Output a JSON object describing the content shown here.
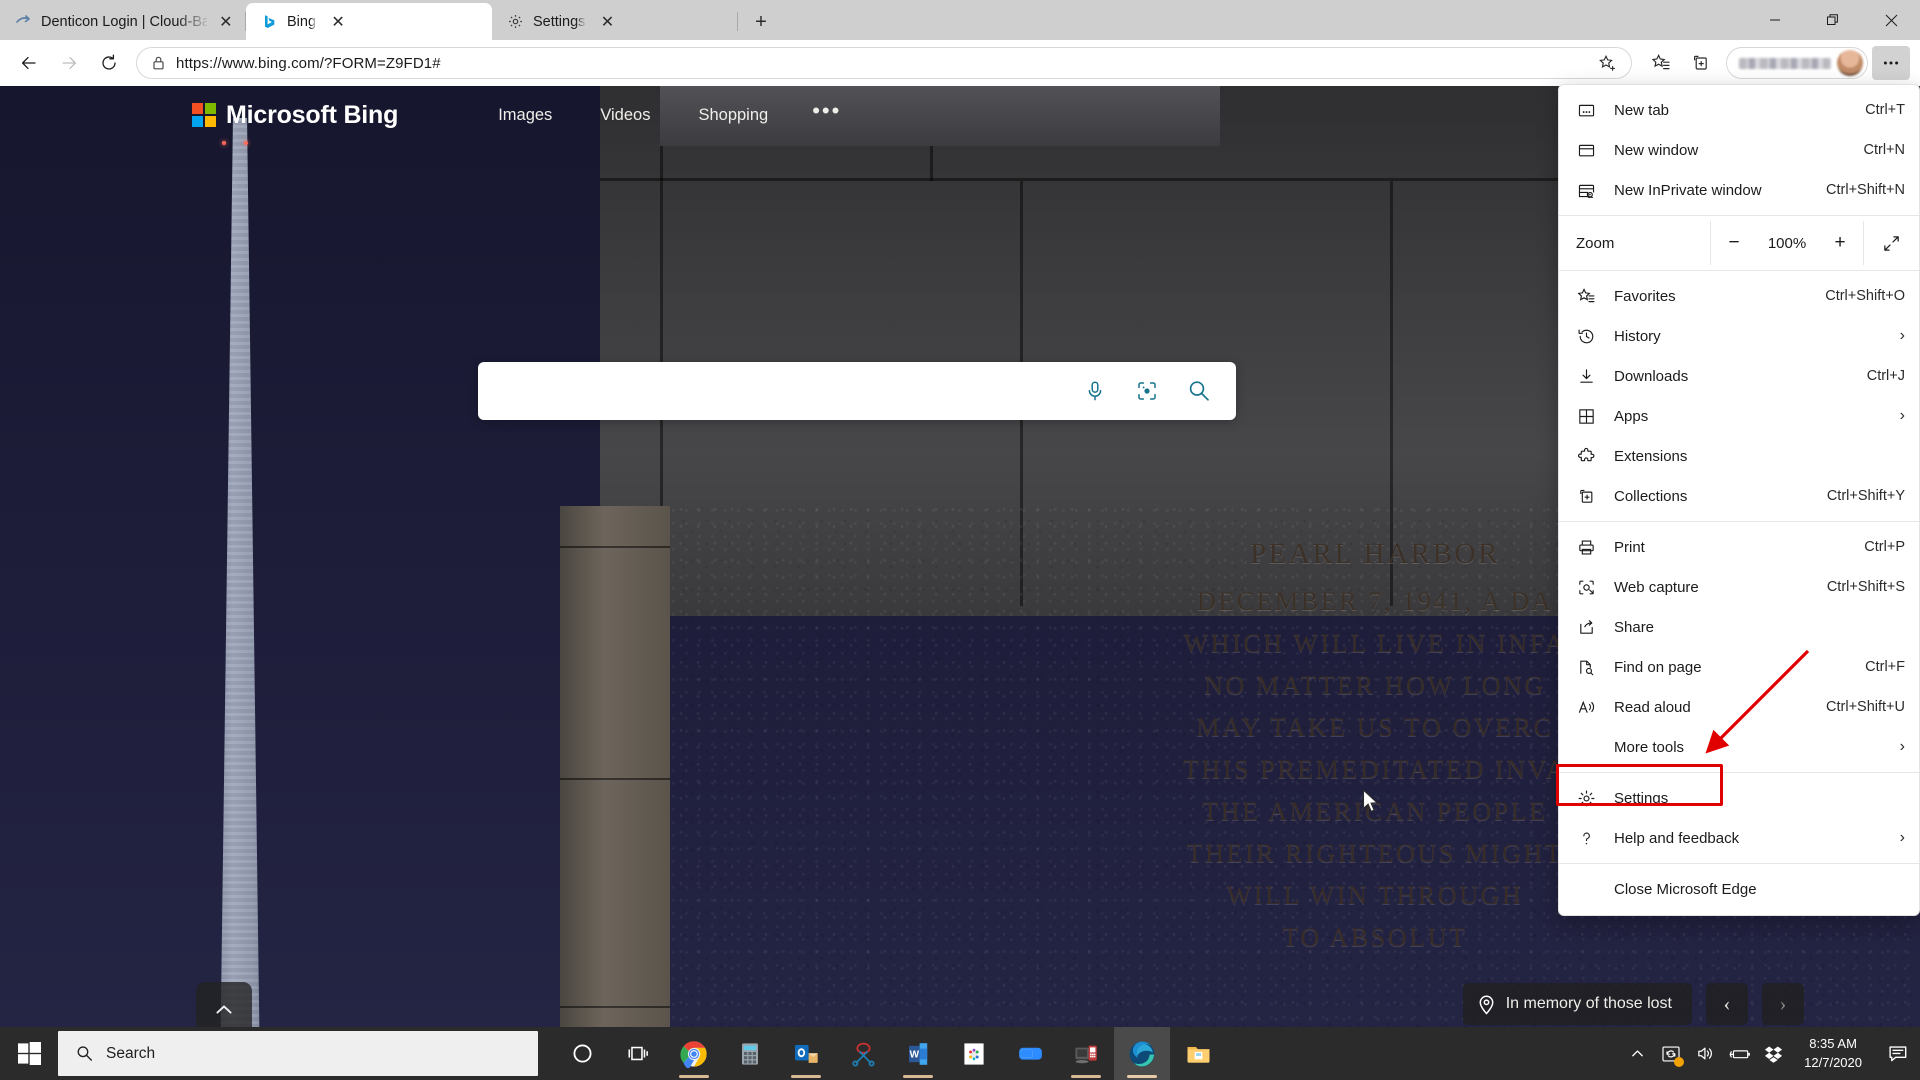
{
  "window": {
    "controls": {
      "minimize": "—",
      "restore": "restore",
      "close": "✕"
    }
  },
  "tabs": [
    {
      "title": "Denticon Login | Cloud-Based Pr",
      "favicon": "denticon-icon",
      "active": false,
      "close": "✕"
    },
    {
      "title": "Bing",
      "favicon": "bing-icon",
      "active": true,
      "close": "✕"
    },
    {
      "title": "Settings",
      "favicon": "gear-icon",
      "active": false,
      "close": "✕"
    }
  ],
  "new_tab_button": "+",
  "toolbar": {
    "back": "back-arrow-icon",
    "forward": "forward-arrow-icon",
    "refresh": "refresh-icon",
    "url": "https://www.bing.com/?FORM=Z9FD1#",
    "url_scheme": "https://",
    "url_rest": "www.bing.com/?FORM=Z9FD1#",
    "lock": "lock-icon",
    "add_favorite": "star-plus-icon",
    "favorites": "favorites-icon",
    "collections": "collections-icon",
    "profile_name": "",
    "more": "…"
  },
  "bing": {
    "logo_text": "Microsoft Bing",
    "nav": [
      "Images",
      "Videos",
      "Shopping"
    ],
    "nav_more": "•••",
    "search_placeholder": "",
    "search_value": "",
    "search_icons": [
      "microphone-icon",
      "visual-search-icon",
      "search-icon"
    ],
    "scroll_top": "chevron-up-icon",
    "infobar_text": "In memory of those lost",
    "infobar_icon": "location-pin-icon",
    "prev_arrow": "‹",
    "next_arrow": "›",
    "inscription": {
      "title": "PEARL HARBOR",
      "lines": [
        "DECEMBER 7, 1941, A DA",
        "WHICH WILL LIVE IN INFA",
        "NO MATTER HOW LONG",
        "MAY TAKE US TO OVERC",
        "THIS PREMEDITATED INVA",
        "THE AMERICAN PEOPLE",
        "THEIR RIGHTEOUS MIGHT",
        "WILL WIN THROUGH",
        "TO ABSOLUT"
      ]
    }
  },
  "edge_menu": {
    "groups": [
      {
        "items": [
          {
            "label": "New tab",
            "accel": "Ctrl+T",
            "icon": "new-tab-icon",
            "chevron": false
          },
          {
            "label": "New window",
            "accel": "Ctrl+N",
            "icon": "new-window-icon",
            "chevron": false
          },
          {
            "label": "New InPrivate window",
            "accel": "Ctrl+Shift+N",
            "icon": "inprivate-icon",
            "chevron": false
          }
        ]
      },
      {
        "zoom": {
          "label": "Zoom",
          "minus": "−",
          "value": "100%",
          "plus": "+",
          "fullscreen": "fullscreen-icon"
        }
      },
      {
        "items": [
          {
            "label": "Favorites",
            "accel": "Ctrl+Shift+O",
            "icon": "favorites-icon",
            "chevron": false
          },
          {
            "label": "History",
            "accel": "",
            "icon": "history-icon",
            "chevron": true
          },
          {
            "label": "Downloads",
            "accel": "Ctrl+J",
            "icon": "downloads-icon",
            "chevron": false
          },
          {
            "label": "Apps",
            "accel": "",
            "icon": "apps-icon",
            "chevron": true
          },
          {
            "label": "Extensions",
            "accel": "",
            "icon": "extensions-icon",
            "chevron": false
          },
          {
            "label": "Collections",
            "accel": "Ctrl+Shift+Y",
            "icon": "collections-icon",
            "chevron": false
          }
        ]
      },
      {
        "items": [
          {
            "label": "Print",
            "accel": "Ctrl+P",
            "icon": "print-icon",
            "chevron": false
          },
          {
            "label": "Web capture",
            "accel": "Ctrl+Shift+S",
            "icon": "web-capture-icon",
            "chevron": false
          },
          {
            "label": "Share",
            "accel": "",
            "icon": "share-icon",
            "chevron": false
          },
          {
            "label": "Find on page",
            "accel": "Ctrl+F",
            "icon": "find-icon",
            "chevron": false
          },
          {
            "label": "Read aloud",
            "accel": "Ctrl+Shift+U",
            "icon": "read-aloud-icon",
            "chevron": false
          },
          {
            "label": "More tools",
            "accel": "",
            "icon": "none",
            "chevron": true
          }
        ]
      },
      {
        "items": [
          {
            "label": "Settings",
            "accel": "",
            "icon": "gear-icon",
            "chevron": false,
            "highlighted": true
          },
          {
            "label": "Help and feedback",
            "accel": "",
            "icon": "help-icon",
            "chevron": true
          }
        ]
      },
      {
        "items": [
          {
            "label": "Close Microsoft Edge",
            "accel": "",
            "icon": "none",
            "chevron": false
          }
        ]
      }
    ]
  },
  "annotation": {
    "color": "#e00000",
    "target": "Settings"
  },
  "taskbar": {
    "start": "windows-logo-icon",
    "search_placeholder": "Search",
    "search_icon": "search-icon",
    "pinned": [
      {
        "name": "cortana-icon"
      },
      {
        "name": "task-view-icon"
      },
      {
        "name": "google-chrome-icon",
        "running": true
      },
      {
        "name": "calculator-icon",
        "running": false
      },
      {
        "name": "outlook-icon",
        "running": true
      },
      {
        "name": "snipping-tool-icon",
        "running": false
      },
      {
        "name": "microsoft-word-icon",
        "running": true
      },
      {
        "name": "paint-icon",
        "running": false
      },
      {
        "name": "zoom-icon",
        "running": false
      },
      {
        "name": "remote-desktop-icon",
        "running": true
      },
      {
        "name": "microsoft-edge-icon",
        "running": true,
        "focused": true
      },
      {
        "name": "file-explorer-icon",
        "running": false
      }
    ],
    "tray": [
      {
        "name": "show-hidden-icons-icon"
      },
      {
        "name": "onedrive-sync-icon"
      },
      {
        "name": "volume-icon"
      },
      {
        "name": "battery-icon"
      },
      {
        "name": "dropbox-icon"
      }
    ],
    "clock_time": "8:35 AM",
    "clock_date": "12/7/2020",
    "action_center": "action-center-icon"
  },
  "colors": {
    "edge_blue": "#0f6cbd",
    "bing_teal": "#1a7790",
    "annotation_red": "#e00000",
    "taskbar": "#2b2b2b",
    "tabstrip": "#cfcfcf"
  }
}
